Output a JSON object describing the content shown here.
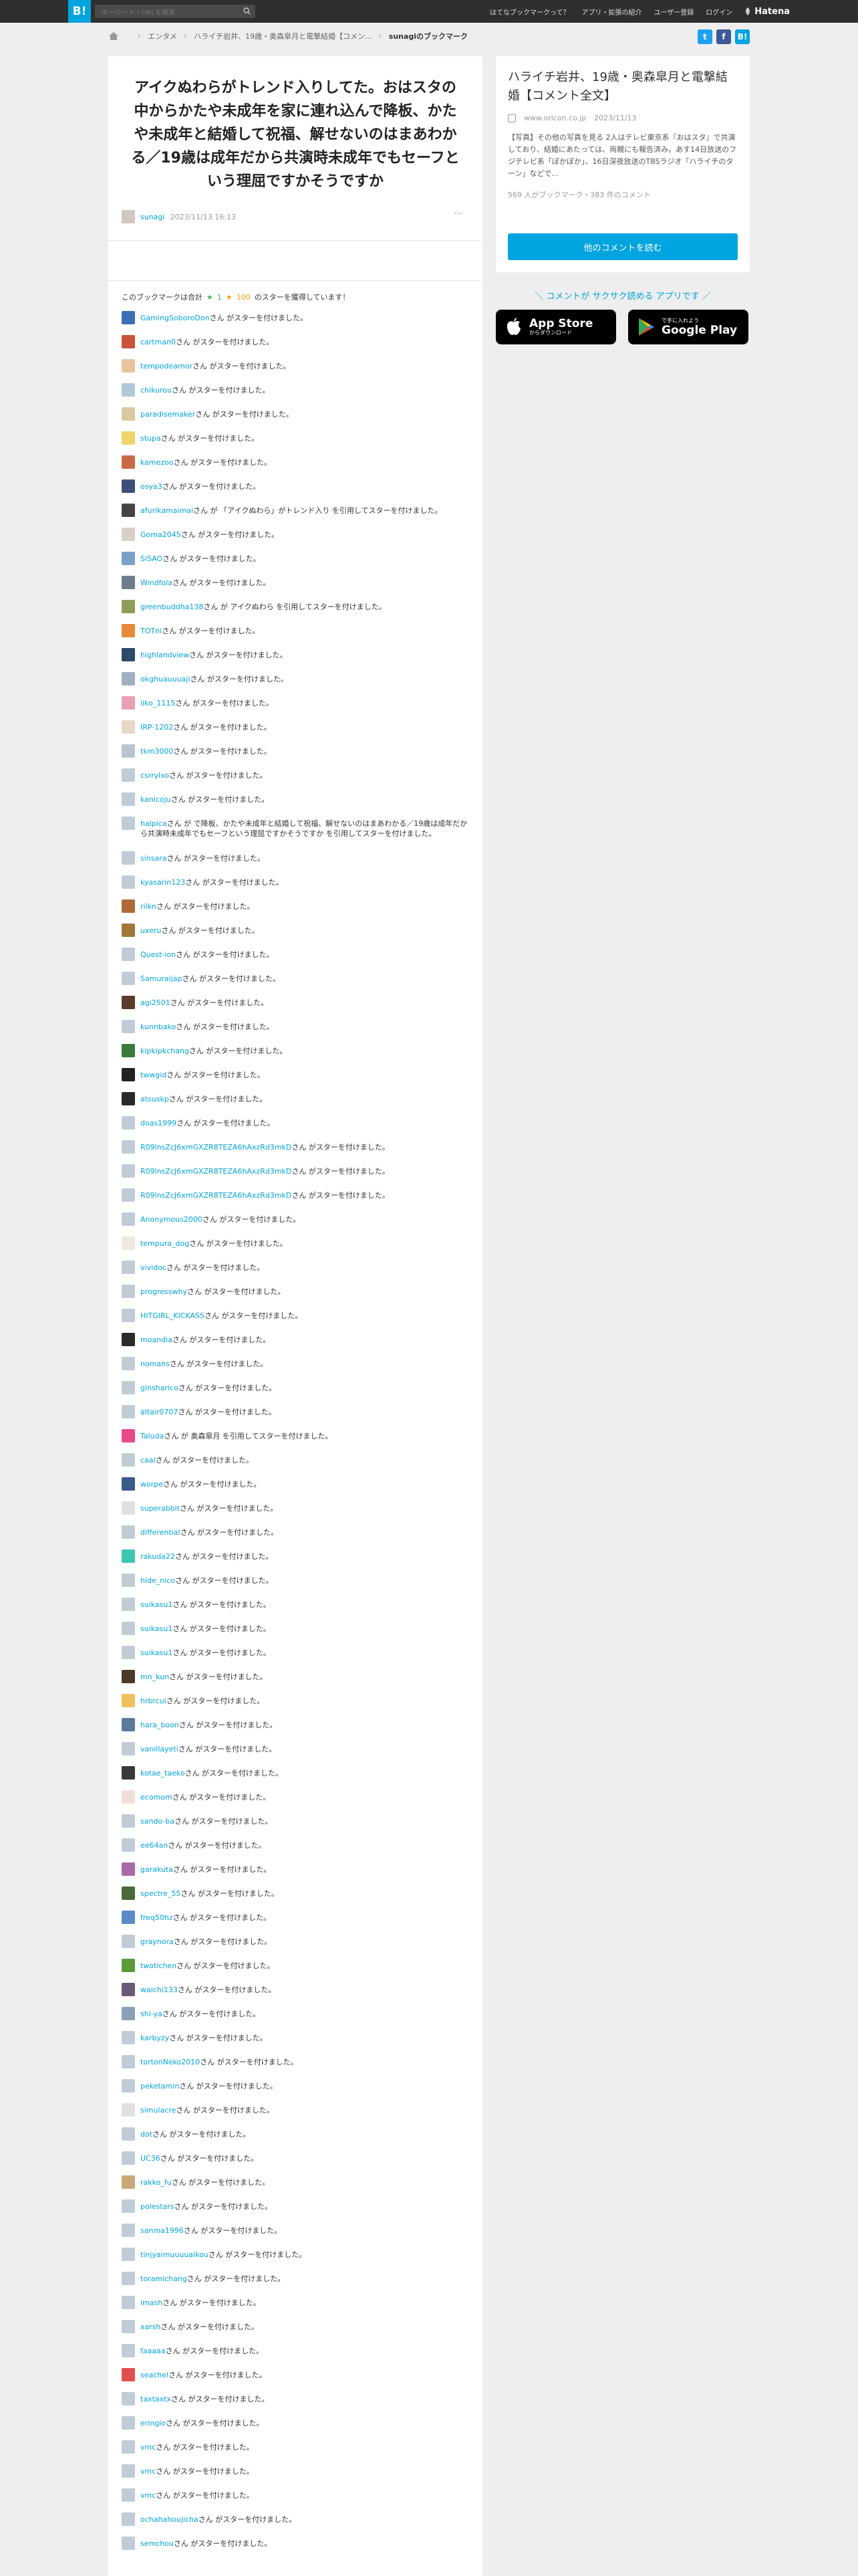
{
  "topbar": {
    "logo": "B!",
    "search_placeholder": "キーワード・URLを検索",
    "nav": [
      "はてなブックマークって？",
      "アプリ・拡張の紹介",
      "ユーザー登録",
      "ログイン"
    ],
    "brand": "Hatena"
  },
  "breadcrumb": {
    "items": [
      "エンタメ",
      "ハライチ岩井、19歳・奥森皐月と電撃結婚【コメン...",
      "sunagiのブックマーク"
    ]
  },
  "share": {
    "twitter": "t",
    "facebook": "f",
    "hatena": "B!"
  },
  "bookmark": {
    "title": "アイクぬわらがトレンド入りしてた。おはスタの中からかたや未成年を家に連れ込んで降板、かたや未成年と結婚して祝福、解せないのはまあわかる／19歳は成年だから共演時未成年でもセーフという理屈ですかそうですか",
    "user": "sunagi",
    "date": "2023/11/13 16:13",
    "menu": "···"
  },
  "summary": {
    "prefix": "このブックマークは合計",
    "green": "1",
    "yellow": "100",
    "suffix": "のスターを獲得しています！",
    "green_star": "★",
    "yellow_star": "★"
  },
  "stars": [
    {
      "user": "GamingSoboroDon",
      "text": "さん がスターを付けました。",
      "color": "#3b6fb5"
    },
    {
      "user": "cartman0",
      "text": "さん がスターを付けました。",
      "color": "#c9533a"
    },
    {
      "user": "tempodeamor",
      "text": "さん がスターを付けました。",
      "color": "#e8c49e"
    },
    {
      "user": "chikurou",
      "text": "さん がスターを付けました。",
      "color": "#b0c8d8"
    },
    {
      "user": "paradisemaker",
      "text": "さん がスターを付けました。",
      "color": "#d9c9a0"
    },
    {
      "user": "stupa",
      "text": "さん がスターを付けました。",
      "color": "#f1d36b"
    },
    {
      "user": "kamezoo",
      "text": "さん がスターを付けました。",
      "color": "#c96a46"
    },
    {
      "user": "osya3",
      "text": "さん がスターを付けました。",
      "color": "#3f4f7a"
    },
    {
      "user": "afurikamaimai",
      "text": "さん が 「アイクぬわら」がトレンド入り を引用してスターを付けました。",
      "color": "#444444"
    },
    {
      "user": "Goma2045",
      "text": "さん がスターを付けました。",
      "color": "#d8d0c8"
    },
    {
      "user": "SiSAO",
      "text": "さん がスターを付けました。",
      "color": "#7aa0c7"
    },
    {
      "user": "Windfola",
      "text": "さん がスターを付けました。",
      "color": "#6d7d8a"
    },
    {
      "user": "greenbuddha138",
      "text": "さん が アイクぬわら を引用してスターを付けました。",
      "color": "#8e9d5a"
    },
    {
      "user": "TOTni",
      "text": "さん がスターを付けました。",
      "color": "#e8883a"
    },
    {
      "user": "highlandview",
      "text": "さん がスターを付けました。",
      "color": "#2d4a6a"
    },
    {
      "user": "okghuauuuaji",
      "text": "さん がスターを付けました。",
      "color": "#a0b0c0"
    },
    {
      "user": "iiko_1115",
      "text": "さん がスターを付けました。",
      "color": "#e9a0b5"
    },
    {
      "user": "IRP-1202",
      "text": "さん がスターを付けました。",
      "color": "#e8d8c8"
    },
    {
      "user": "tkm3000",
      "text": "さん がスターを付けました。",
      "color": "#b8c4d0"
    },
    {
      "user": "csrrylxo",
      "text": "さん がスターを付けました。",
      "color": "#c0ccd8"
    },
    {
      "user": "kanicoju",
      "text": "さん がスターを付けました。",
      "color": "#c0ccd8"
    },
    {
      "user": "halpica",
      "text": "さん が で降板、かたや未成年と結婚して祝福、解せないのはまあわかる／19歳は成年だから共演時未成年でもセーフという理屈ですかそうですか を引用してスターを付けました。",
      "color": "#c0ccd8",
      "tall": true
    },
    {
      "user": "sinsara",
      "text": "さん がスターを付けました。",
      "color": "#c0ccd8"
    },
    {
      "user": "kyasarin123",
      "text": "さん がスターを付けました。",
      "color": "#c0ccd8"
    },
    {
      "user": "rilkn",
      "text": "さん がスターを付けました。",
      "color": "#b06a3a"
    },
    {
      "user": "uxeru",
      "text": "さん がスターを付けました。",
      "color": "#a0783a"
    },
    {
      "user": "Quest-ion",
      "text": "さん がスターを付けました。",
      "color": "#c0ccd8"
    },
    {
      "user": "Samuraijap",
      "text": "さん がスターを付けました。",
      "color": "#c0ccd8"
    },
    {
      "user": "agi2501",
      "text": "さん がスターを付けました。",
      "color": "#5a3a2a"
    },
    {
      "user": "kunnbako",
      "text": "さん がスターを付けました。",
      "color": "#c0ccd8"
    },
    {
      "user": "kipkipkchang",
      "text": "さん がスターを付けました。",
      "color": "#3a7a3a"
    },
    {
      "user": "twwgid",
      "text": "さん がスターを付けました。",
      "color": "#222222"
    },
    {
      "user": "atsuskp",
      "text": "さん がスターを付けました。",
      "color": "#2a2a2a"
    },
    {
      "user": "doas1999",
      "text": "さん がスターを付けました。",
      "color": "#c0ccd8"
    },
    {
      "user": "R09lnsZcJ6xmGXZR8TEZA6hAxzRd3mkD",
      "text": "さん がスターを付けました。",
      "color": "#c0ccd8"
    },
    {
      "user": "R09lnsZcJ6xmGXZR8TEZA6hAxzRd3mkD",
      "text": "さん がスターを付けました。",
      "color": "#c0ccd8"
    },
    {
      "user": "R09lnsZcJ6xmGXZR8TEZA6hAxzRd3mkD",
      "text": "さん がスターを付けました。",
      "color": "#c0ccd8"
    },
    {
      "user": "Anonymous2000",
      "text": "さん がスターを付けました。",
      "color": "#c0ccd8"
    },
    {
      "user": "tempura_dog",
      "text": "さん がスターを付けました。",
      "color": "#f0e8e0"
    },
    {
      "user": "vividoc",
      "text": "さん がスターを付けました。",
      "color": "#c0ccd8"
    },
    {
      "user": "progresswhy",
      "text": "さん がスターを付けました。",
      "color": "#c0ccd8"
    },
    {
      "user": "HITGIRL_KICKASS",
      "text": "さん がスターを付けました。",
      "color": "#c0ccd8"
    },
    {
      "user": "moandia",
      "text": "さん がスターを付けました。",
      "color": "#2a2a2a"
    },
    {
      "user": "nomans",
      "text": "さん がスターを付けました。",
      "color": "#c0ccd8"
    },
    {
      "user": "ginsharico",
      "text": "さん がスターを付けました。",
      "color": "#c0ccd8"
    },
    {
      "user": "altair0707",
      "text": "さん がスターを付けました。",
      "color": "#c0ccd8"
    },
    {
      "user": "Taluda",
      "text": "さん が 奥森皐月 を引用してスターを付けました。",
      "color": "#e84a8a"
    },
    {
      "user": "caal",
      "text": "さん がスターを付けました。",
      "color": "#c0ccd8"
    },
    {
      "user": "worpe",
      "text": "さん がスターを付けました。",
      "color": "#3a5a8a"
    },
    {
      "user": "superabbit",
      "text": "さん がスターを付けました。",
      "color": "#e0e0e0"
    },
    {
      "user": "differential",
      "text": "さん がスターを付けました。",
      "color": "#c0ccd8"
    },
    {
      "user": "rakuda22",
      "text": "さん がスターを付けました。",
      "color": "#3ac8b0"
    },
    {
      "user": "hide_nico",
      "text": "さん がスターを付けました。",
      "color": "#c0ccd8"
    },
    {
      "user": "suikasu1",
      "text": "さん がスターを付けました。",
      "color": "#c0ccd8"
    },
    {
      "user": "suikasu1",
      "text": "さん がスターを付けました。",
      "color": "#c0ccd8"
    },
    {
      "user": "suikasu1",
      "text": "さん がスターを付けました。",
      "color": "#c0ccd8"
    },
    {
      "user": "mn_kun",
      "text": "さん がスターを付けました。",
      "color": "#4a3a2a"
    },
    {
      "user": "hrbrcui",
      "text": "さん がスターを付けました。",
      "color": "#f0c060"
    },
    {
      "user": "hara_boon",
      "text": "さん がスターを付けました。",
      "color": "#5a7a9a"
    },
    {
      "user": "vanillayeti",
      "text": "さん がスターを付けました。",
      "color": "#c0ccd8"
    },
    {
      "user": "kotae_taeko",
      "text": "さん がスターを付けました。",
      "color": "#3a3a3a"
    },
    {
      "user": "ecomom",
      "text": "さん がスターを付けました。",
      "color": "#f0e0d8"
    },
    {
      "user": "sando-ba",
      "text": "さん がスターを付けました。",
      "color": "#c0ccd8"
    },
    {
      "user": "ee64an",
      "text": "さん がスターを付けました。",
      "color": "#c0ccd8"
    },
    {
      "user": "garakuta",
      "text": "さん がスターを付けました。",
      "color": "#a86aa8"
    },
    {
      "user": "spectre_55",
      "text": "さん がスターを付けました。",
      "color": "#4a6a3a"
    },
    {
      "user": "freq50hz",
      "text": "さん がスターを付けました。",
      "color": "#5a8ac8"
    },
    {
      "user": "graynora",
      "text": "さん がスターを付けました。",
      "color": "#c0ccd8"
    },
    {
      "user": "twotichen",
      "text": "さん がスターを付けました。",
      "color": "#5a9a3a"
    },
    {
      "user": "waichi133",
      "text": "さん がスターを付けました。",
      "color": "#6a5a7a"
    },
    {
      "user": "shi-ya",
      "text": "さん がスターを付けました。",
      "color": "#8aa0b8"
    },
    {
      "user": "karbyzy",
      "text": "さん がスターを付けました。",
      "color": "#c0ccd8"
    },
    {
      "user": "tortonNeko2010",
      "text": "さん がスターを付けました。",
      "color": "#c0ccd8"
    },
    {
      "user": "peketamin",
      "text": "さん がスターを付けました。",
      "color": "#c0ccd8"
    },
    {
      "user": "simulacre",
      "text": "さん がスターを付けました。",
      "color": "#e0e0e0"
    },
    {
      "user": "dot",
      "text": "さん がスターを付けました。",
      "color": "#c0ccd8"
    },
    {
      "user": "UC36",
      "text": "さん がスターを付けました。",
      "color": "#c0ccd8"
    },
    {
      "user": "rakko_fu",
      "text": "さん がスターを付けました。",
      "color": "#c8a878"
    },
    {
      "user": "polestars",
      "text": "さん がスターを付けました。",
      "color": "#c0ccd8"
    },
    {
      "user": "sanma1996",
      "text": "さん がスターを付けました。",
      "color": "#c0ccd8"
    },
    {
      "user": "tinjyaimuuuuaikou",
      "text": "さん がスターを付けました。",
      "color": "#c0ccd8"
    },
    {
      "user": "toramichang",
      "text": "さん がスターを付けました。",
      "color": "#c0ccd8"
    },
    {
      "user": "imash",
      "text": "さん がスターを付けました。",
      "color": "#c0ccd8"
    },
    {
      "user": "xarsh",
      "text": "さん がスターを付けました。",
      "color": "#c0ccd8"
    },
    {
      "user": "faaaaa",
      "text": "さん がスターを付けました。",
      "color": "#c0ccd8"
    },
    {
      "user": "seachel",
      "text": "さん がスターを付けました。",
      "color": "#e05050"
    },
    {
      "user": "taxtaxtx",
      "text": "さん がスターを付けました。",
      "color": "#c0ccd8"
    },
    {
      "user": "eringio",
      "text": "さん がスターを付けました。",
      "color": "#c0ccd8"
    },
    {
      "user": "vmc",
      "text": "さん がスターを付けました。",
      "color": "#c0ccd8"
    },
    {
      "user": "vmc",
      "text": "さん がスターを付けました。",
      "color": "#c0ccd8"
    },
    {
      "user": "vmc",
      "text": "さん がスターを付けました。",
      "color": "#c0ccd8"
    },
    {
      "user": "ochahahoujicha",
      "text": "さん がスターを付けました。",
      "color": "#c0ccd8"
    },
    {
      "user": "semchou",
      "text": "さん がスターを付けました。",
      "color": "#c0ccd8"
    }
  ],
  "sidebar": {
    "entry_title": "ハライチ岩井、19歳・奥森皐月と電撃結婚【コメント全文】",
    "domain": "www.oricon.co.jp",
    "date": "2023/11/13",
    "description": "【写真】その他の写真を見る 2人はテレビ東京系『おはスタ』で共演しており、結婚にあたっては、両親にも報告済み。あす14日放送のフジテレビ系「ぽかぽか」、16日深夜放送のTBSラジオ「ハライチのターン」などで…",
    "counts": "569 人がブックマーク・383 件のコメント",
    "more_button": "他のコメントを読む",
    "app_promo": "＼ コメントが サクサク読める アプリです ／",
    "appstore_small": "からダウンロード",
    "appstore_big": "App Store",
    "googleplay_small": "で手に入れよう",
    "googleplay_big": "Google Play"
  }
}
